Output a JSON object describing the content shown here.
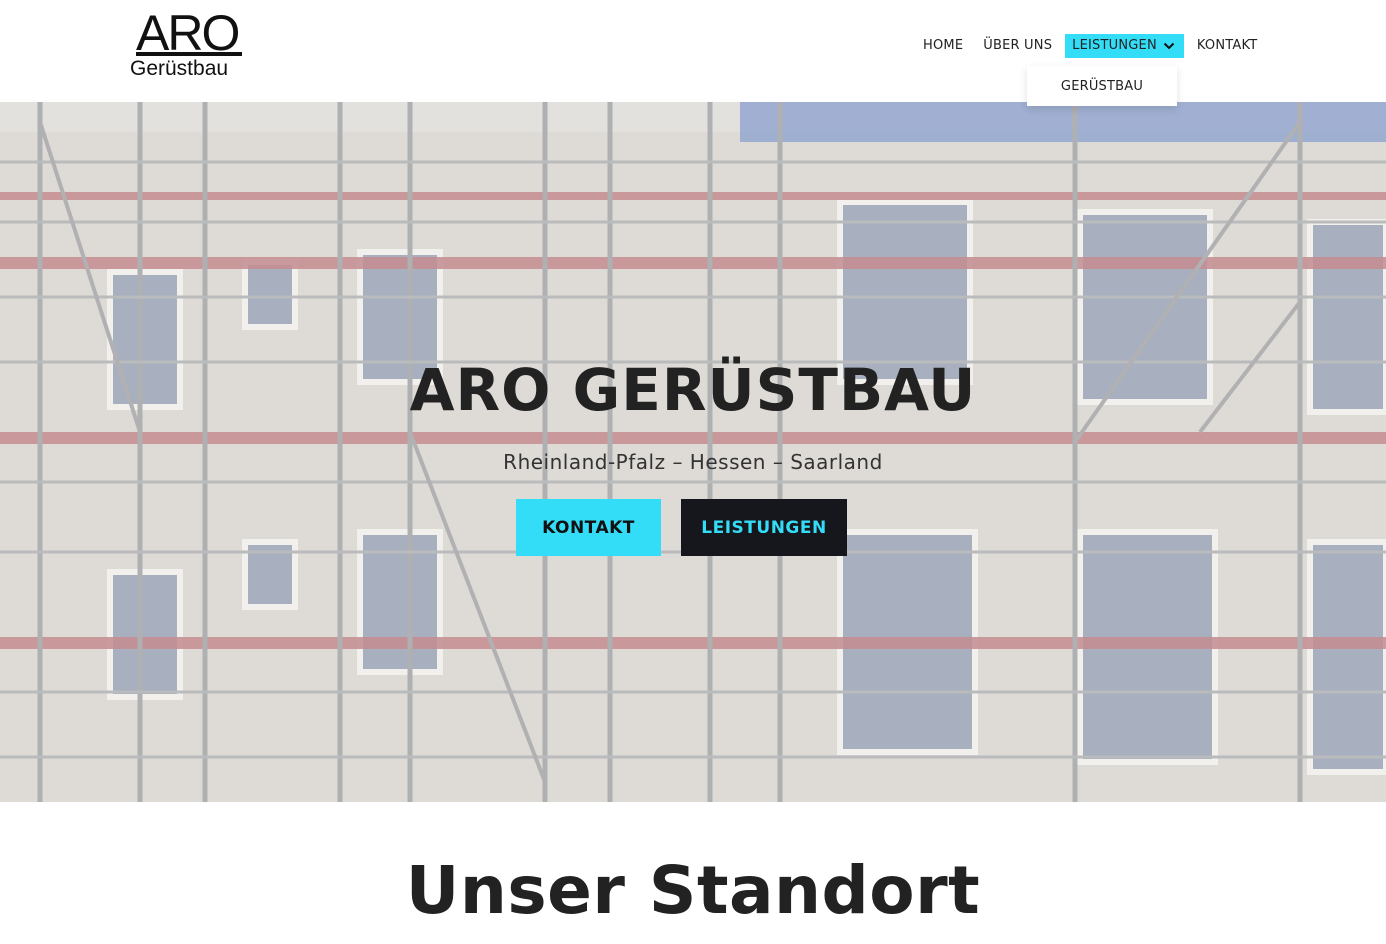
{
  "logo": {
    "main": "ARO",
    "sub": "Gerüstbau"
  },
  "nav": {
    "items": [
      {
        "label": "HOME"
      },
      {
        "label": "ÜBER UNS"
      },
      {
        "label": "LEISTUNGEN"
      },
      {
        "label": "KONTAKT"
      }
    ],
    "dropdown": {
      "items": [
        {
          "label": "GERÜSTBAU"
        }
      ]
    }
  },
  "hero": {
    "title": "ARO GERÜSTBAU",
    "subtitle": "Rheinland-Pfalz – Hessen – Saarland",
    "buttons": {
      "kontakt": "KONTAKT",
      "leistungen": "LEISTUNGEN"
    }
  },
  "section": {
    "title": "Unser Standort"
  },
  "colors": {
    "accent": "#33ddf7",
    "dark": "#15171c",
    "text": "#222222"
  },
  "icons": {
    "dropdown": "chevron-down-icon"
  }
}
